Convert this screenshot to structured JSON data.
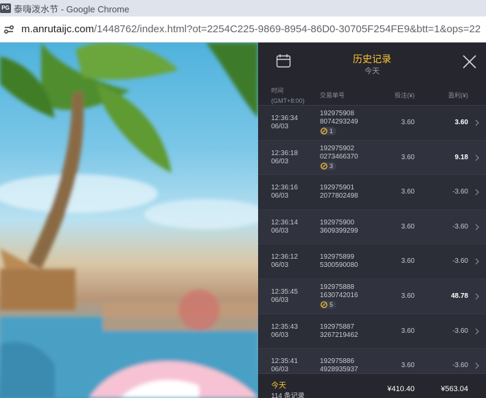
{
  "browser": {
    "icon_text": "PG",
    "title": "泰嗨泼水节 - Google Chrome",
    "url_host": "m.anrutaijc.com",
    "url_rest": "/1448762/index.html?ot=2254C225-9869-8954-86D0-30705F254FE9&btt=1&ops=22"
  },
  "panel": {
    "title": "历史记录",
    "subtitle": "今天",
    "columns": {
      "time": "时间",
      "timezone": "(GMT+8:00)",
      "order": "交易单号",
      "bet": "投注(¥)",
      "profit": "盈利(¥)"
    },
    "rows": [
      {
        "time": "12:36:34",
        "date": "06/03",
        "order_a": "192975908",
        "order_b": "8074293249",
        "badge": "1",
        "bet": "3.60",
        "profit": "3.60"
      },
      {
        "time": "12:36:18",
        "date": "06/03",
        "order_a": "192975902",
        "order_b": "0273466370",
        "badge": "3",
        "bet": "3.60",
        "profit": "9.18"
      },
      {
        "time": "12:36:16",
        "date": "06/03",
        "order_a": "192975901",
        "order_b": "2077802498",
        "badge": "",
        "bet": "3.60",
        "profit": "-3.60"
      },
      {
        "time": "12:36:14",
        "date": "06/03",
        "order_a": "192975900",
        "order_b": "3609399299",
        "badge": "",
        "bet": "3.60",
        "profit": "-3.60"
      },
      {
        "time": "12:36:12",
        "date": "06/03",
        "order_a": "192975899",
        "order_b": "5300590080",
        "badge": "",
        "bet": "3.60",
        "profit": "-3.60"
      },
      {
        "time": "12:35:45",
        "date": "06/03",
        "order_a": "192975888",
        "order_b": "1630742016",
        "badge": "5",
        "bet": "3.60",
        "profit": "48.78"
      },
      {
        "time": "12:35:43",
        "date": "06/03",
        "order_a": "192975887",
        "order_b": "3267219462",
        "badge": "",
        "bet": "3.60",
        "profit": "-3.60"
      },
      {
        "time": "12:35:41",
        "date": "06/03",
        "order_a": "192975886",
        "order_b": "4928935937",
        "badge": "",
        "bet": "3.60",
        "profit": "-3.60"
      }
    ],
    "footer": {
      "label": "今天",
      "count": "114 条记录",
      "total_bet": "¥410.40",
      "total_profit": "¥563.04"
    }
  },
  "icons": {
    "calendar": "calendar-icon",
    "close": "close-icon",
    "chevron": "chevron-right-icon",
    "coin": "free-spin-coin-icon",
    "site_settings": "site-settings-icon"
  },
  "colors": {
    "accent": "#ffc533",
    "panel_bg": "#2b2d37",
    "header_bg": "#25262e"
  }
}
